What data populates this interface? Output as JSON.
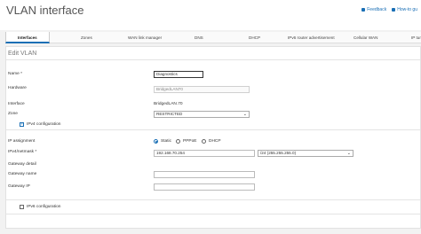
{
  "header": {
    "title": "VLAN interface",
    "links": [
      {
        "label": "Feedback",
        "icon": "feedback-icon"
      },
      {
        "label": "How-to gu",
        "icon": "help-icon"
      }
    ]
  },
  "tabs": [
    {
      "label": "Interfaces",
      "active": true
    },
    {
      "label": "Zones"
    },
    {
      "label": "WAN link manager"
    },
    {
      "label": "DNS"
    },
    {
      "label": "DHCP"
    },
    {
      "label": "IPv6 router advertisement"
    },
    {
      "label": "Cellular WAN"
    },
    {
      "label": "IP tun"
    }
  ],
  "form": {
    "section_title": "Edit VLAN",
    "name": {
      "label": "Name *",
      "value": "Diagnostics"
    },
    "hardware": {
      "label": "Hardware",
      "value": "BridgedLAN70"
    },
    "interface": {
      "label": "Interface",
      "value": "BridgedLAN.70"
    },
    "zone": {
      "label": "Zone",
      "value": "RESTRICTED"
    },
    "ipv4_config": {
      "label": "IPv4 configuration",
      "checked": true
    },
    "ip_assignment": {
      "label": "IP assignment",
      "options": [
        "Static",
        "PPPoE",
        "DHCP"
      ],
      "selected": "Static"
    },
    "ipv4_netmask": {
      "label": "IPv4/netmask *",
      "ip": "192.168.70.254",
      "mask": "/24 (255.255.255.0)"
    },
    "gateway_detail": {
      "label": "Gateway detail"
    },
    "gateway_name": {
      "label": "Gateway name",
      "value": ""
    },
    "gateway_ip": {
      "label": "Gateway IP",
      "value": ""
    },
    "ipv6_config": {
      "label": "IPv6 configuration",
      "checked": false
    }
  },
  "colors": {
    "accent": "#1a6fb5",
    "background": "#f2f2f2"
  }
}
